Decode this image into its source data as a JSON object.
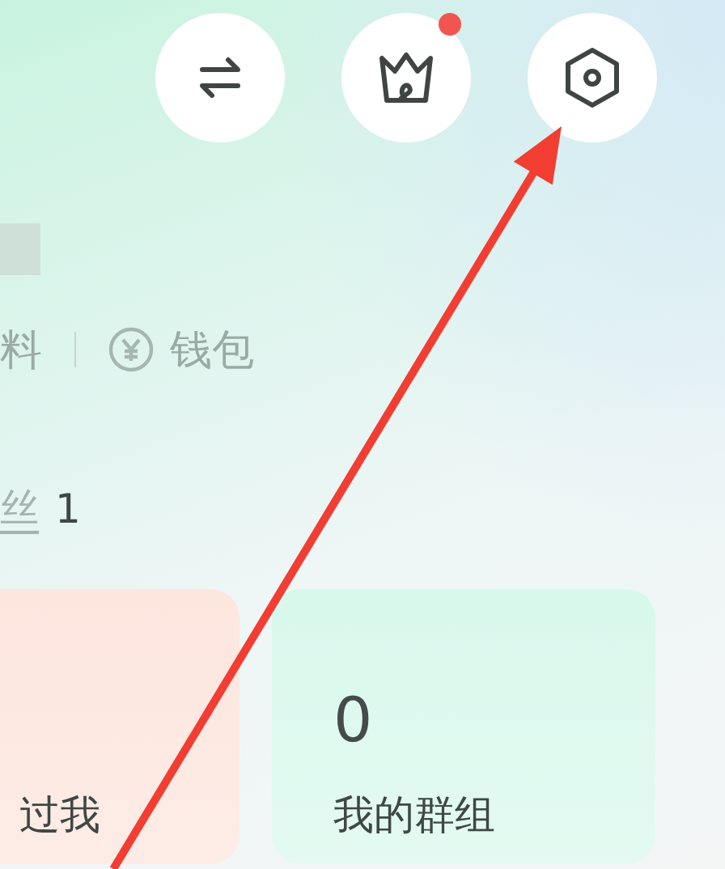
{
  "top_buttons": [
    {
      "kind": "switch",
      "notification": false
    },
    {
      "kind": "crown",
      "notification": true
    },
    {
      "kind": "settings",
      "notification": false
    }
  ],
  "profile_links": [
    {
      "kind": "text",
      "label": "料"
    },
    {
      "kind": "wallet",
      "label": "钱包"
    }
  ],
  "fans": {
    "label": "丝",
    "count": "1"
  },
  "cards": [
    {
      "kind": "visitors",
      "label": "过我"
    },
    {
      "kind": "groups",
      "value": "0",
      "label": "我的群组"
    }
  ],
  "annotation": {
    "kind": "arrow"
  }
}
